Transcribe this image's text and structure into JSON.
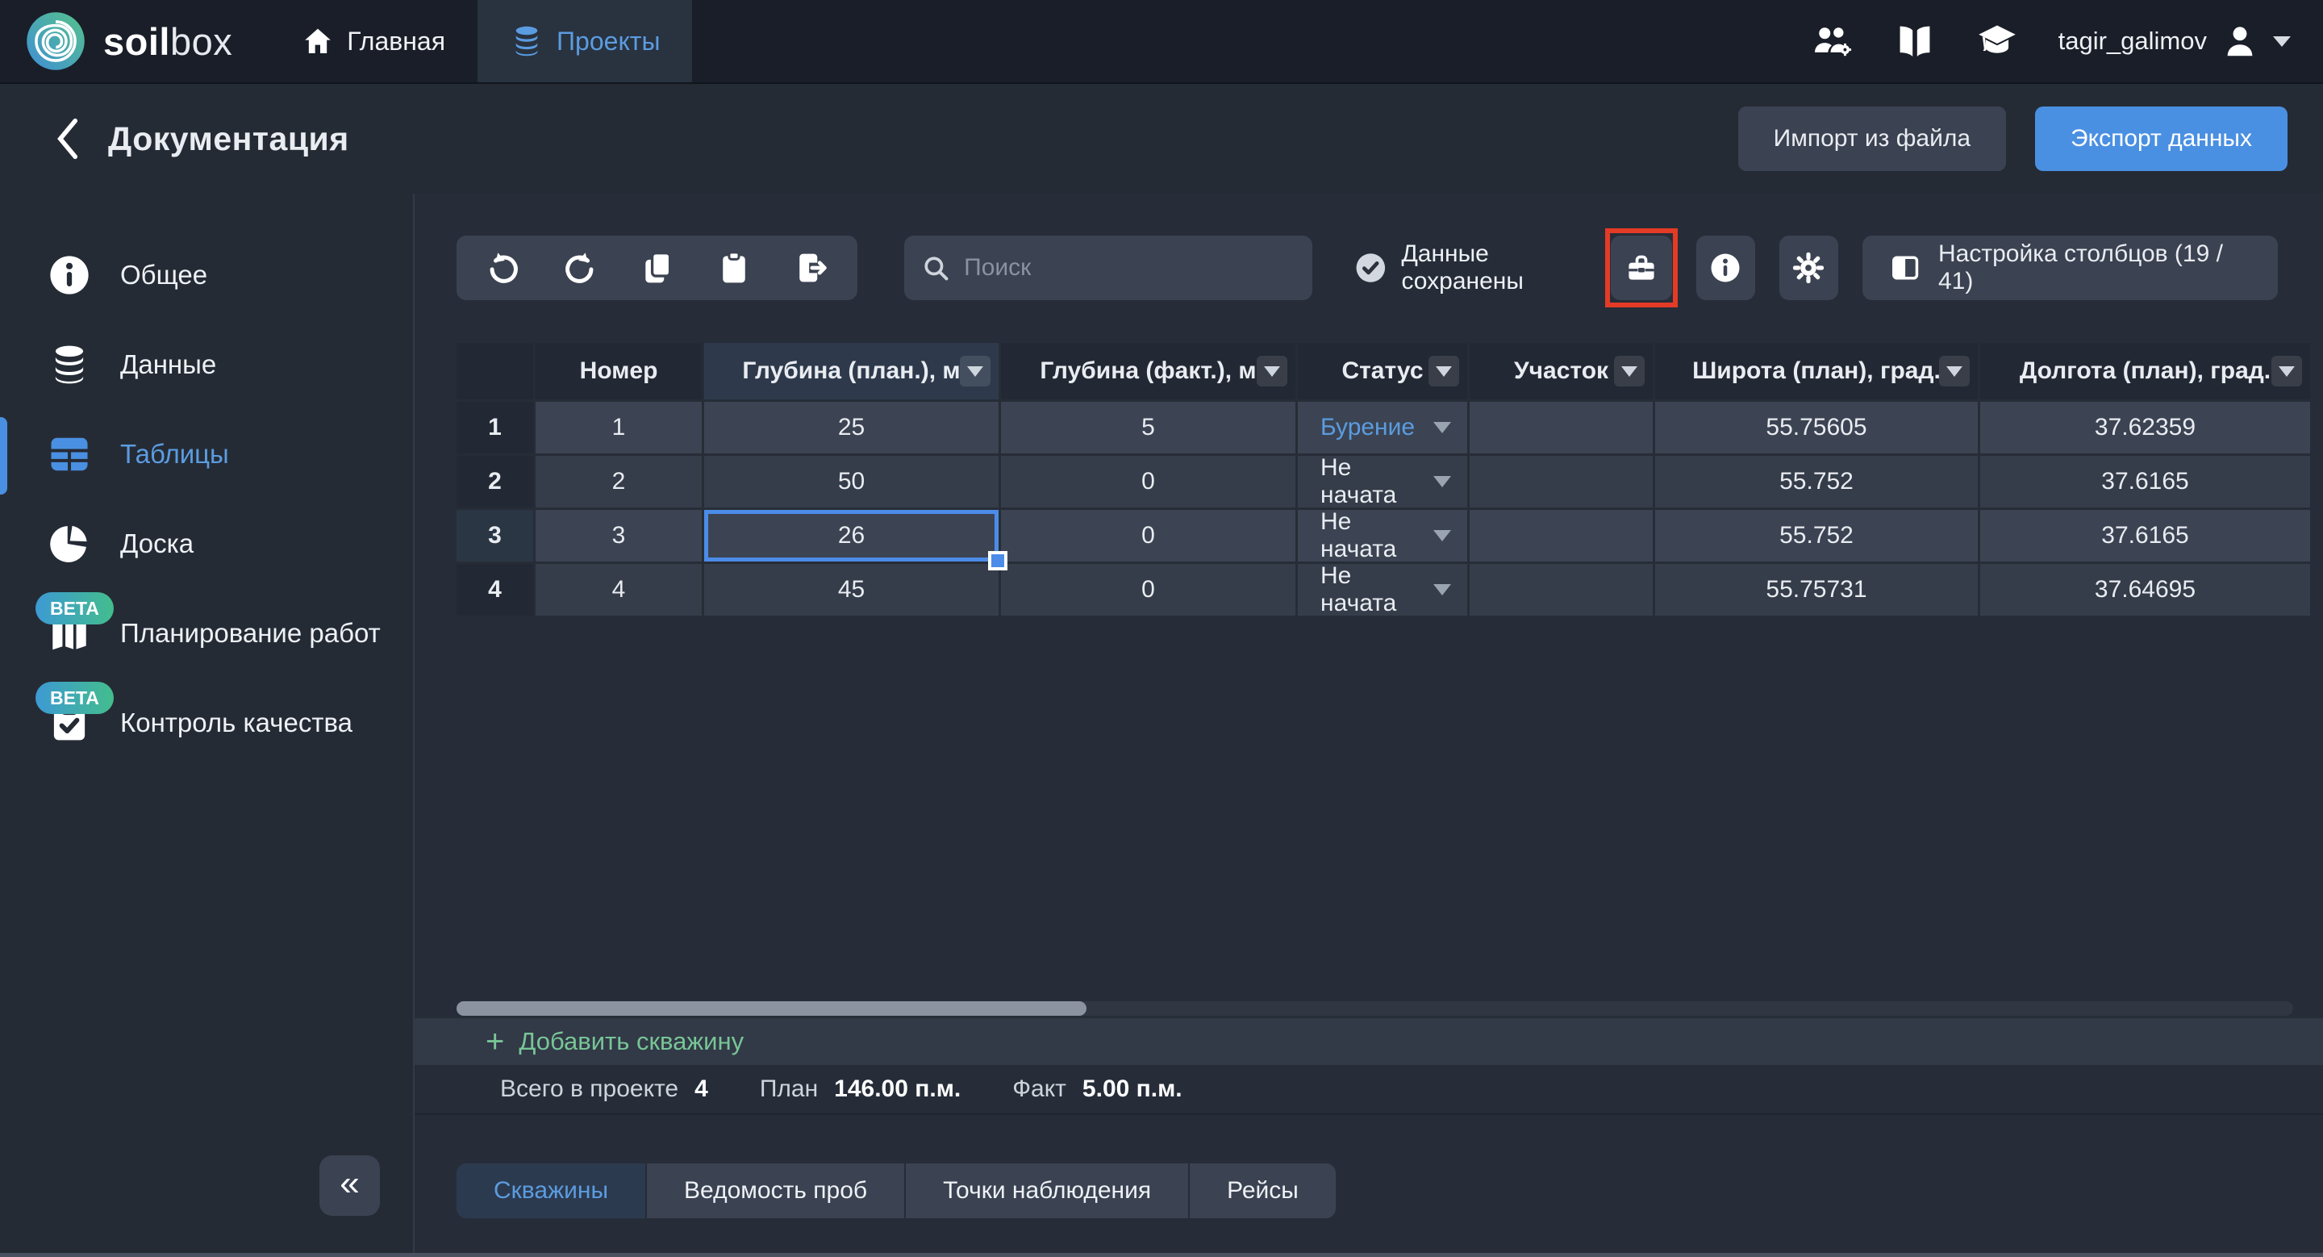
{
  "brand": {
    "bold": "soil",
    "light": "box"
  },
  "topnav": {
    "home": "Главная",
    "projects": "Проекты",
    "username": "tagir_galimov"
  },
  "header": {
    "title": "Документация",
    "import_button": "Импорт из файла",
    "export_button": "Экспорт данных"
  },
  "sidebar": {
    "items": [
      {
        "label": "Общее"
      },
      {
        "label": "Данные"
      },
      {
        "label": "Таблицы",
        "active": true
      },
      {
        "label": "Доска"
      },
      {
        "label": "Планирование работ",
        "beta": "BETA"
      },
      {
        "label": "Контроль качества",
        "beta": "BETA"
      }
    ],
    "collapse": "«"
  },
  "toolbar": {
    "search_placeholder": "Поиск",
    "saved_status": "Данные сохранены",
    "columns_button": "Настройка столбцов (19 / 41)"
  },
  "table": {
    "columns": [
      "Номер",
      "Глубина (план.), м",
      "Глубина (факт.), м",
      "Статус",
      "Участок",
      "Широта (план), град.",
      "Долгота (план), град."
    ],
    "rows": [
      {
        "row": "1",
        "num": "1",
        "plan": "25",
        "fact": "5",
        "status": "Бурение",
        "status_active": true,
        "uchastok": "",
        "lat": "55.75605",
        "lon": "37.62359"
      },
      {
        "row": "2",
        "num": "2",
        "plan": "50",
        "fact": "0",
        "status": "Не начата",
        "uchastok": "",
        "lat": "55.752",
        "lon": "37.6165"
      },
      {
        "row": "3",
        "num": "3",
        "plan": "26",
        "fact": "0",
        "status": "Не начата",
        "uchastok": "",
        "lat": "55.752",
        "lon": "37.6165",
        "selected": true,
        "selected_cell": "plan"
      },
      {
        "row": "4",
        "num": "4",
        "plan": "45",
        "fact": "0",
        "status": "Не начата",
        "uchastok": "",
        "lat": "55.75731",
        "lon": "37.64695"
      }
    ]
  },
  "footer": {
    "add_label": "Добавить скважину",
    "plus": "+",
    "total_label": "Всего в проекте",
    "total_value": "4",
    "plan_label": "План",
    "plan_value": "146.00 п.м.",
    "fact_label": "Факт",
    "fact_value": "5.00 п.м."
  },
  "bottom_tabs": [
    {
      "label": "Скважины",
      "active": true
    },
    {
      "label": "Ведомость проб"
    },
    {
      "label": "Точки наблюдения"
    },
    {
      "label": "Рейсы"
    }
  ],
  "colors": {
    "accent": "#4a90e2",
    "link_blue": "#5b9ce0",
    "green": "#78c596",
    "annotation_red": "#e43b27",
    "beta_gradient_start": "#3d9ad3",
    "beta_gradient_end": "#43bd8d",
    "status_drilling": "#5b9ce0"
  }
}
